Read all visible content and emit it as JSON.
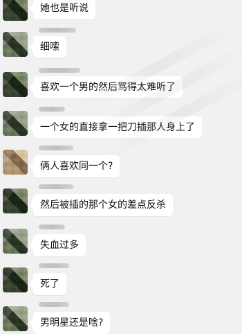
{
  "messages": [
    {
      "text": "她也是听说"
    },
    {
      "text": "细嗦"
    },
    {
      "text": "喜欢一个男的然后骂得太难听了"
    },
    {
      "text": "一个女的直接拿一把刀插那人身上了"
    },
    {
      "text": "俩人喜欢同一个?"
    },
    {
      "text": "然后被插的那个女的差点反杀"
    },
    {
      "text": "失血过多"
    },
    {
      "text": "死了"
    },
    {
      "text": "男明星还是啥?"
    }
  ]
}
